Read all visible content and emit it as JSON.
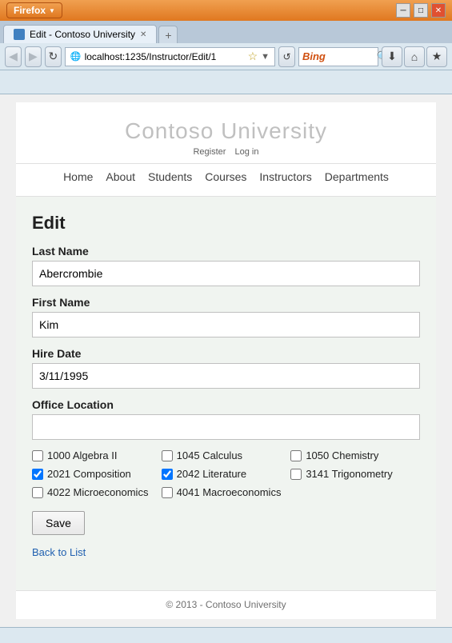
{
  "browser": {
    "title": "Edit - Contoso University",
    "firefox_label": "Firefox",
    "url": "localhost:1235/Instructor/Edit/1",
    "tab_label": "Edit - Contoso University",
    "new_tab_icon": "+",
    "back_btn": "◀",
    "forward_btn": "▶",
    "refresh_btn": "↻",
    "home_btn": "⌂",
    "minimize_btn": "─",
    "maximize_btn": "□",
    "close_btn": "✕",
    "search_placeholder": "Bing",
    "bing_label": "Bing"
  },
  "site": {
    "title": "Contoso University",
    "register_link": "Register",
    "login_link": "Log in",
    "nav_items": [
      "Home",
      "About",
      "Students",
      "Courses",
      "Instructors",
      "Departments"
    ]
  },
  "form": {
    "heading": "Edit",
    "last_name_label": "Last Name",
    "last_name_value": "Abercrombie",
    "first_name_label": "First Name",
    "first_name_value": "Kim",
    "hire_date_label": "Hire Date",
    "hire_date_value": "3/11/1995",
    "office_location_label": "Office Location",
    "office_location_value": "",
    "save_button": "Save",
    "back_link": "Back to List",
    "courses": [
      {
        "id": "1000",
        "label": "Algebra II",
        "checked": false
      },
      {
        "id": "1045",
        "label": "Calculus",
        "checked": false
      },
      {
        "id": "1050",
        "label": "Chemistry",
        "checked": false
      },
      {
        "id": "2021",
        "label": "Composition",
        "checked": true
      },
      {
        "id": "2042",
        "label": "Literature",
        "checked": true
      },
      {
        "id": "3141",
        "label": "Trigonometry",
        "checked": false
      },
      {
        "id": "4022",
        "label": "Microeconomics",
        "checked": false
      },
      {
        "id": "4041",
        "label": "Macroeconomics",
        "checked": false
      }
    ]
  },
  "footer": {
    "copyright": "© 2013 - Contoso University"
  }
}
